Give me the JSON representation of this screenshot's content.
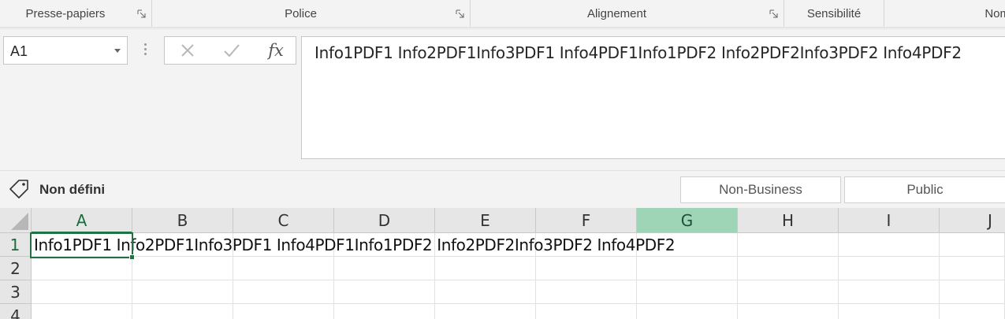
{
  "ribbon": {
    "groups": [
      {
        "label": "Presse-papiers"
      },
      {
        "label": "Police"
      },
      {
        "label": "Alignement"
      },
      {
        "label": "Sensibilité"
      },
      {
        "label": "Nom"
      }
    ]
  },
  "formula_bar": {
    "name_box": "A1",
    "cancel_icon": "x-icon",
    "enter_icon": "check-icon",
    "function_label": "fx",
    "content": "Info1PDF1 Info2PDF1Info3PDF1 Info4PDF1Info1PDF2 Info2PDF2Info3PDF2 Info4PDF2"
  },
  "sensitivity": {
    "label": "Non défini",
    "options": [
      "Non-Business",
      "Public"
    ]
  },
  "grid": {
    "columns": [
      "A",
      "B",
      "C",
      "D",
      "E",
      "F",
      "G",
      "H",
      "I",
      "J"
    ],
    "rows": [
      "1",
      "2",
      "3",
      "4"
    ],
    "active_cell": "A1",
    "selected_column": "G",
    "cells": {
      "A1": "Info1PDF1 Info2PDF1Info3PDF1 Info4PDF1Info1PDF2 Info2PDF2Info3PDF2 Info4PDF2"
    }
  },
  "colors": {
    "accent": "#217346",
    "selected_header": "#9fd5b7",
    "header_bg": "#e6e6e6"
  }
}
